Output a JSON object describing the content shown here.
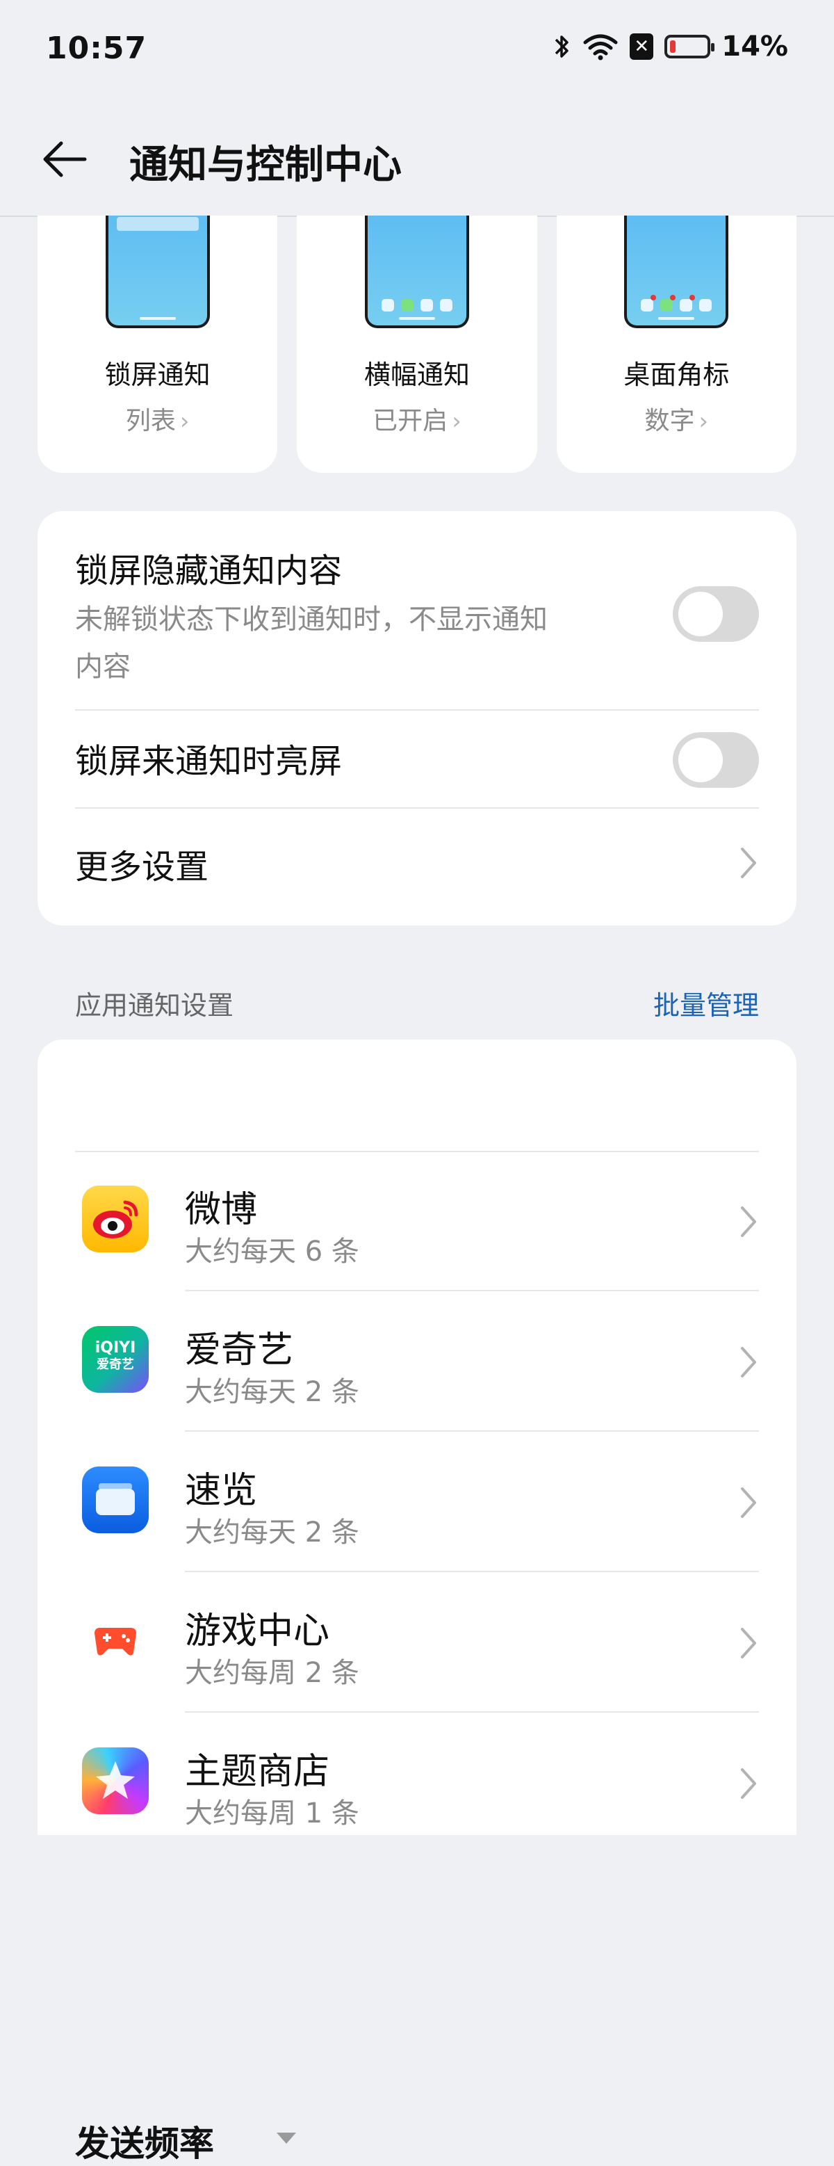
{
  "status": {
    "time": "10:57",
    "battery": "14%"
  },
  "header": {
    "title": "通知与控制中心"
  },
  "preview_cards": [
    {
      "label": "锁屏通知",
      "value": "列表"
    },
    {
      "label": "横幅通知",
      "value": "已开启"
    },
    {
      "label": "桌面角标",
      "value": "数字"
    }
  ],
  "settings": {
    "hide_content": {
      "title": "锁屏隐藏通知内容",
      "subtitle_line1": "未解锁状态下收到通知时，不显示通知",
      "subtitle_line2": "内容",
      "enabled": false
    },
    "wake_screen": {
      "title": "锁屏来通知时亮屏",
      "enabled": false
    },
    "more": {
      "title": "更多设置"
    }
  },
  "app_section": {
    "label": "应用通知设置",
    "action": "批量管理",
    "sort_label": "发送频率"
  },
  "apps": [
    {
      "name": "微博",
      "freq": "大约每天 6 条",
      "icon": "weibo-icon"
    },
    {
      "name": "爱奇艺",
      "freq": "大约每天 2 条",
      "icon": "iqiyi-icon",
      "icon_text1": "iQIYI",
      "icon_text2": "爱奇艺"
    },
    {
      "name": "速览",
      "freq": "大约每天 2 条",
      "icon": "sulan-icon"
    },
    {
      "name": "游戏中心",
      "freq": "大约每周 2 条",
      "icon": "game-center-icon"
    },
    {
      "name": "主题商店",
      "freq": "大约每周 1 条",
      "icon": "theme-store-icon"
    }
  ],
  "colors": {
    "accent": "#1d63b8",
    "background": "#eef0f4",
    "toggle_off": "#d9d9d9"
  }
}
